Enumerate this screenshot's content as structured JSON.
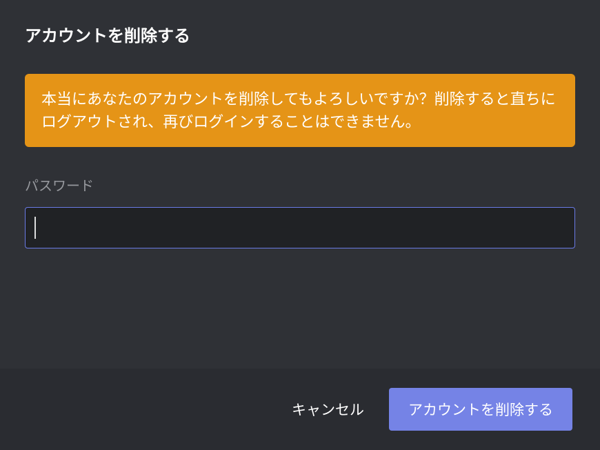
{
  "modal": {
    "title": "アカウントを削除する",
    "warning_message": "本当にあなたのアカウントを削除してもよろしいですか？削除すると直ちにログアウトされ、再びログインすることはできません。",
    "password_label": "パスワード",
    "password_value": ""
  },
  "footer": {
    "cancel_label": "キャンセル",
    "delete_label": "アカウントを削除する"
  }
}
